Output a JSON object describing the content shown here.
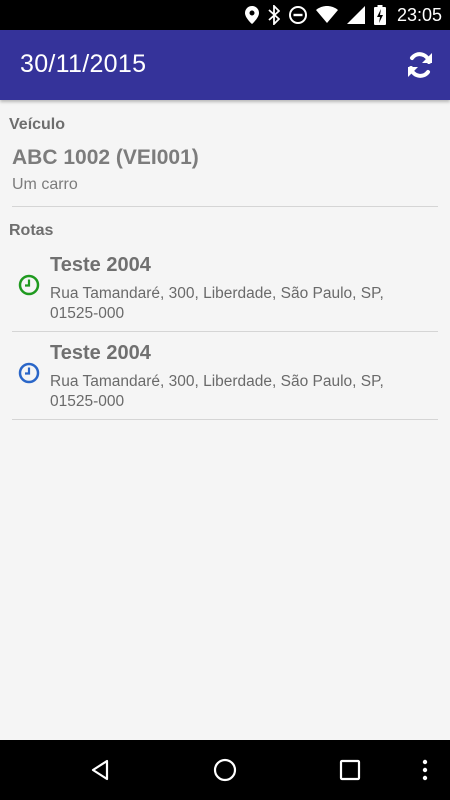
{
  "status_bar": {
    "time": "23:05",
    "icons": [
      "location-icon",
      "bluetooth-icon",
      "do-not-disturb-icon",
      "wifi-icon",
      "signal-icon",
      "battery-charging-icon"
    ]
  },
  "app_bar": {
    "title": "30/11/2015",
    "action_icon": "refresh-icon",
    "color": "#35339a"
  },
  "vehicle_section": {
    "label": "Veículo",
    "title": "ABC 1002 (VEI001)",
    "subtitle": "Um carro"
  },
  "routes_section": {
    "label": "Rotas",
    "items": [
      {
        "name": "Teste 2004",
        "address_line1": "Rua Tamandaré, 300, Liberdade, São Paulo, SP,",
        "address_line2": "01525-000",
        "icon": "clock-icon",
        "icon_color": "#1f9a1f"
      },
      {
        "name": "Teste 2004",
        "address_line1": "Rua Tamandaré, 300, Liberdade, São Paulo, SP,",
        "address_line2": "01525-000",
        "icon": "clock-icon",
        "icon_color": "#2a66c8"
      }
    ]
  },
  "nav_bar": {
    "buttons": [
      "back-icon",
      "home-icon",
      "recents-icon",
      "overflow-menu-icon"
    ]
  }
}
